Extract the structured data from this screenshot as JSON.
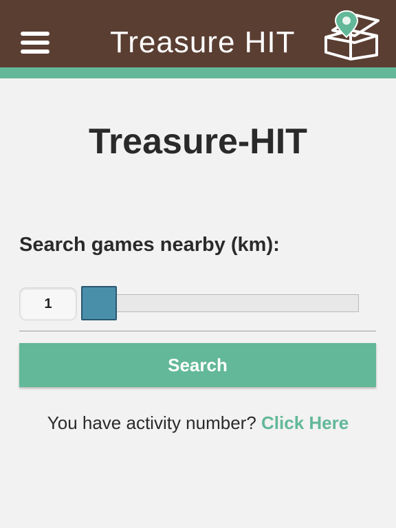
{
  "header": {
    "title": "Treasure HIT",
    "menu_icon": "hamburger-menu-icon",
    "logo_icon": "treasure-box-location-pin-icon"
  },
  "main": {
    "page_title": "Treasure-HIT",
    "search_label": "Search games nearby (km):",
    "distance_value": "1",
    "slider_level": 0,
    "search_button_label": "Search",
    "activity_prompt": "You have activity number?",
    "activity_link_label": "Click Here"
  },
  "colors": {
    "header_brown": "#5a3e32",
    "accent_green": "#62b898",
    "slider_thumb_blue": "#4a8faa",
    "background": "#f2f2f2",
    "text": "#2a2a2a"
  }
}
